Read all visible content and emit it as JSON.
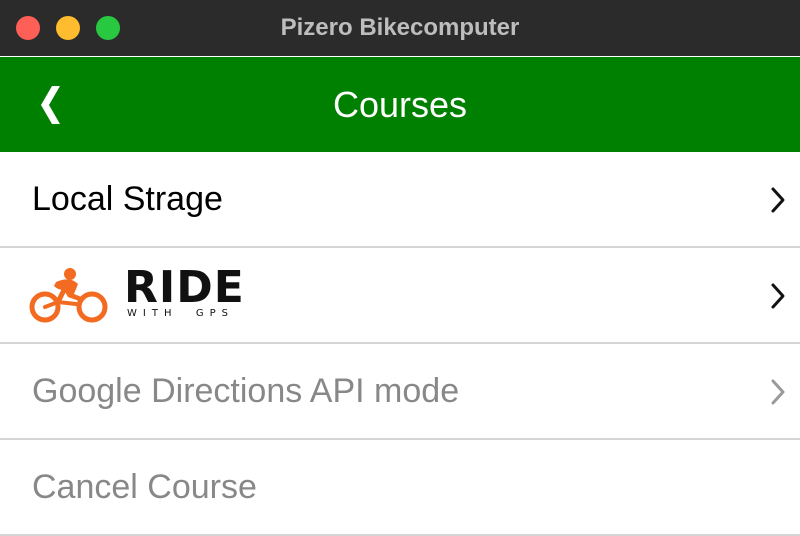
{
  "window": {
    "title": "Pizero Bikecomputer"
  },
  "header": {
    "title": "Courses",
    "back_icon": "chevron-left-icon"
  },
  "menu": {
    "items": [
      {
        "label": "Local Strage",
        "enabled": true,
        "icon": "chevron-right-icon"
      },
      {
        "logo_word": "RIDE",
        "logo_sub": "WITH  GPS",
        "enabled": true,
        "icon": "chevron-right-icon"
      },
      {
        "label": "Google Directions API mode",
        "enabled": false,
        "icon": "chevron-right-icon"
      },
      {
        "label": "Cancel Course",
        "enabled": false
      }
    ]
  },
  "colors": {
    "titlebar": "#2b2b2b",
    "header": "#008000",
    "header_text": "#ffffff",
    "disabled_text": "#888888",
    "separator": "#d4d4d4",
    "logo_orange": "#f26b21"
  }
}
